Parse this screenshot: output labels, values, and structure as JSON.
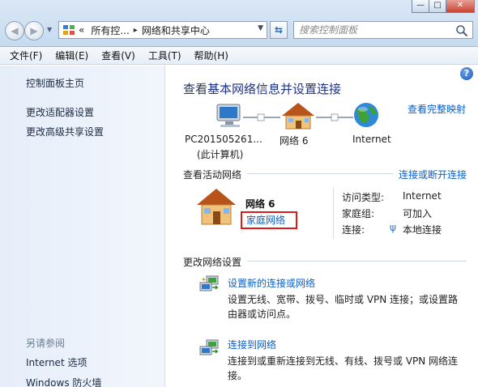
{
  "window": {
    "controls": {
      "minimize": "—",
      "maximize": "□",
      "close": "✕"
    }
  },
  "address_bar": {
    "overflow": "«",
    "crumbs": [
      "所有控...",
      "网络和共享中心"
    ],
    "separator": "▸"
  },
  "search": {
    "placeholder": "搜索控制面板"
  },
  "menu": [
    "文件(F)",
    "编辑(E)",
    "查看(V)",
    "工具(T)",
    "帮助(H)"
  ],
  "sidebar": {
    "items": [
      "控制面板主页",
      "更改适配器设置",
      "更改高级共享设置"
    ],
    "see_also_heading": "另请参阅",
    "see_also": [
      "Internet 选项",
      "Windows 防火墙"
    ]
  },
  "main": {
    "help": "?",
    "title": "查看基本网络信息并设置连接",
    "view_full_map": "查看完整映射",
    "map": {
      "computer_name": "PC201505261...",
      "computer_sub": "(此计算机)",
      "network": "网络  6",
      "internet": "Internet"
    },
    "active_networks": {
      "heading": "查看活动网络",
      "connect_link": "连接或断开连接",
      "network_name": "网络  6",
      "network_type": "家庭网络",
      "access_type_label": "访问类型:",
      "access_type_value": "Internet",
      "homegroup_label": "家庭组:",
      "homegroup_value": "可加入",
      "connections_label": "连接:",
      "connections_value": "本地连接"
    },
    "change_settings": {
      "heading": "更改网络设置",
      "tasks": [
        {
          "link": "设置新的连接或网络",
          "desc": "设置无线、宽带、拨号、临时或 VPN 连接；或设置路由器或访问点。"
        },
        {
          "link": "连接到网络",
          "desc": "连接到或重新连接到无线、有线、拨号或 VPN 网络连接。"
        }
      ]
    }
  },
  "colors": {
    "link": "#0b5ec7",
    "title": "#1e3287",
    "highlight_box": "#e01818"
  }
}
